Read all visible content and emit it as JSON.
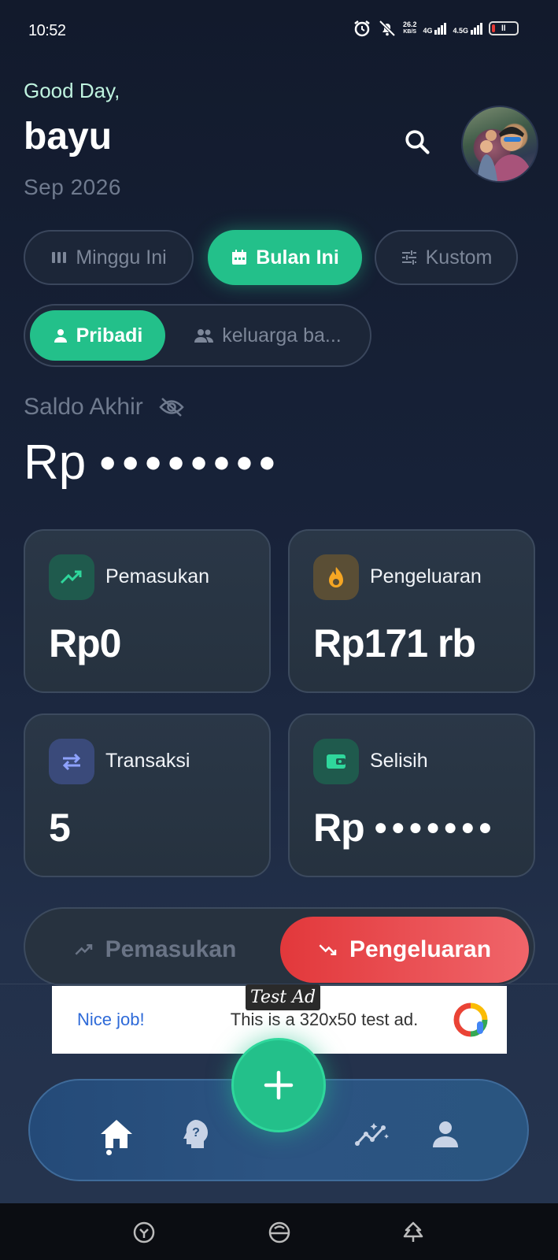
{
  "status_bar": {
    "time": "10:52",
    "net_speed": "26.2",
    "net_unit": "KB/S",
    "sim1": "4G",
    "sim2": "4.5G"
  },
  "header": {
    "greeting": "Good Day,",
    "username": "bayu",
    "period": "Sep 2026"
  },
  "filters": {
    "range": [
      {
        "label": "Minggu Ini",
        "icon": "bars-icon"
      },
      {
        "label": "Bulan Ini",
        "icon": "calendar-icon",
        "active": true
      },
      {
        "label": "Kustom",
        "icon": "sliders-icon"
      }
    ],
    "scope": [
      {
        "label": "Pribadi",
        "icon": "person-icon",
        "active": true
      },
      {
        "label": "keluarga ba...",
        "icon": "group-icon"
      }
    ]
  },
  "balance": {
    "label": "Saldo Akhir",
    "currency": "Rp",
    "masked": "●●●●●●●●"
  },
  "cards": {
    "income": {
      "label": "Pemasukan",
      "value": "Rp0",
      "icon": "trending-up-icon"
    },
    "expense": {
      "label": "Pengeluaran",
      "value": "Rp171 rb",
      "icon": "fire-icon"
    },
    "transactions": {
      "label": "Transaksi",
      "value": "5",
      "icon": "swap-icon"
    },
    "difference": {
      "label": "Selisih",
      "value": "Rp",
      "masked": "●●●●●●●",
      "icon": "wallet-icon"
    }
  },
  "toggle": {
    "income_label": "Pemasukan",
    "expense_label": "Pengeluaran"
  },
  "ad": {
    "tag": "Test Ad",
    "title": "Nice job!",
    "text": "This is a 320x50 test ad."
  },
  "nav": {
    "items": [
      "home-icon",
      "help-icon",
      "add-icon",
      "insights-icon",
      "profile-icon"
    ]
  },
  "colors": {
    "accent": "#23c08a",
    "expense": "#e2383b",
    "nav": "#2c5482"
  }
}
